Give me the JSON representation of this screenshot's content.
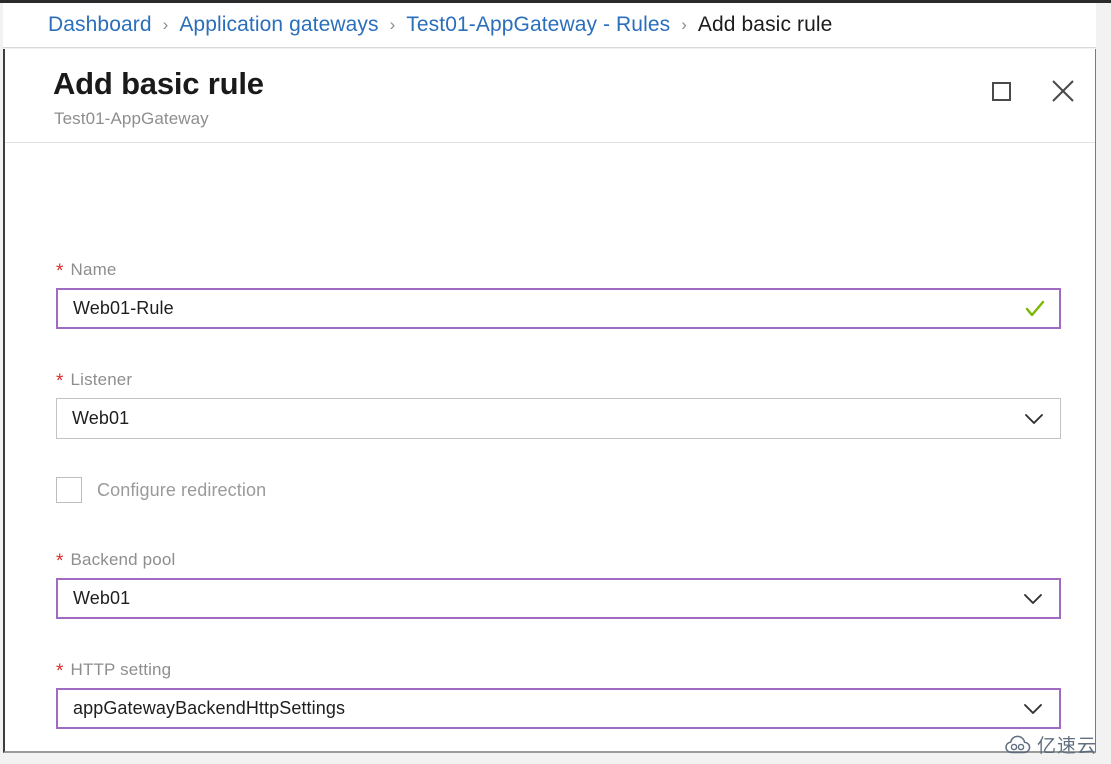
{
  "breadcrumb": {
    "separator": "›",
    "items": [
      {
        "label": "Dashboard",
        "current": false
      },
      {
        "label": "Application gateways",
        "current": false
      },
      {
        "label": "Test01-AppGateway - Rules",
        "current": false
      },
      {
        "label": "Add basic rule",
        "current": true
      }
    ]
  },
  "blade": {
    "title": "Add basic rule",
    "subtitle": "Test01-AppGateway",
    "window_controls": {
      "maximize_name": "maximize-button",
      "close_name": "close-button",
      "close_glyph": "✕"
    }
  },
  "form": {
    "name_field": {
      "label": "Name",
      "required_marker": "*",
      "value": "Web01-Rule",
      "validation": "valid",
      "border_color": "#a06bc0",
      "check_color": "#7ab800"
    },
    "listener_field": {
      "label": "Listener",
      "required_marker": "*",
      "value": "Web01",
      "border_color": "#c3c3c3"
    },
    "redirection_checkbox": {
      "label": "Configure redirection",
      "checked": false
    },
    "backend_pool_field": {
      "label": "Backend pool",
      "required_marker": "*",
      "value": "Web01",
      "border_color": "#a06bc0"
    },
    "http_setting_field": {
      "label": "HTTP setting",
      "required_marker": "*",
      "value": "appGatewayBackendHttpSettings",
      "border_color": "#a06bc0"
    }
  },
  "watermark": {
    "text": "亿速云"
  }
}
